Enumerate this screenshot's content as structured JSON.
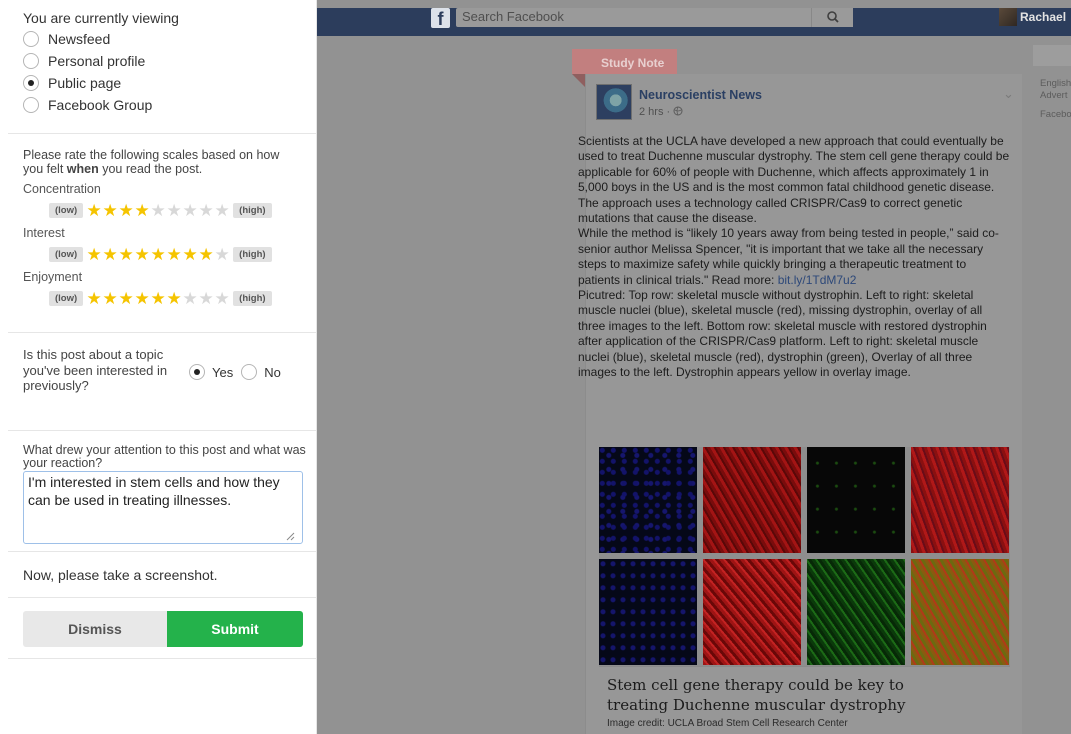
{
  "survey": {
    "viewing_title": "You are currently viewing",
    "viewing_options": [
      {
        "label": "Newsfeed",
        "selected": false
      },
      {
        "label": "Personal profile",
        "selected": false
      },
      {
        "label": "Public page",
        "selected": true
      },
      {
        "label": "Facebook Group",
        "selected": false
      }
    ],
    "rate_intro_before": "Please rate the following scales based on how you felt ",
    "rate_intro_bold": "when",
    "rate_intro_after": " you read the post.",
    "low_label": "(low)",
    "high_label": "(high)",
    "scales": [
      {
        "label": "Concentration",
        "rating": 4,
        "max": 9
      },
      {
        "label": "Interest",
        "rating": 8,
        "max": 9
      },
      {
        "label": "Enjoyment",
        "rating": 6,
        "max": 9
      }
    ],
    "topic_question": "Is this post about a topic you've been interested in previously?",
    "topic_yes": "Yes",
    "topic_no": "No",
    "topic_answer": "Yes",
    "reaction_question": "What drew your attention to this post and what was your reaction?",
    "reaction_value": "I'm interested in stem cells and how they can be used in treating illnesses. ",
    "screenshot_prompt": "Now, please take a screenshot.",
    "dismiss_label": "Dismiss",
    "submit_label": "Submit"
  },
  "facebook": {
    "search_placeholder": "Search Facebook",
    "user_name": "Rachael",
    "study_note_label": "Study Note",
    "side_lines": [
      "English",
      "Advert",
      "Facebo"
    ],
    "post": {
      "author": "Neuroscientist News",
      "meta": "2 hrs · ",
      "paragraphs": [
        "Scientists at the UCLA have developed a new approach that could eventually be used to treat Duchenne muscular dystrophy. The stem cell gene therapy could be applicable for 60% of people with Duchenne, which affects approximately 1 in 5,000 boys in the US and is the most common fatal childhood genetic disease.",
        "The approach uses a technology called CRISPR/Cas9 to correct genetic mutations that cause the disease."
      ],
      "quote_text": "While the method is “likely 10 years away from being tested in people,” said co-senior author Melissa Spencer, \"it is important that we take all the necessary steps to maximize safety while quickly bringing a therapeutic treatment to patients in clinical trials.\" Read more: ",
      "link_text": "bit.ly/1TdM7u2",
      "caption": "Picutred: Top row: skeletal muscle without dystrophin. Left to right: skeletal muscle nuclei (blue), skeletal muscle (red), missing dystrophin, overlay of all three images to the left. Bottom row: skeletal muscle with restored dystrophin after application of the CRISPR/Cas9 platform. Left to right: skeletal muscle nuclei (blue), skeletal muscle (red), dystrophin (green), Overlay of all three images to the left. Dystrophin appears yellow in overlay image.",
      "article_title": "Stem cell gene therapy could be key to treating Duchenne muscular dystrophy",
      "article_credit": "Image credit: UCLA Broad Stem Cell Research Center"
    }
  },
  "colors": {
    "accent_submit": "#24b24b",
    "star_on": "#f5c400",
    "fb_bar": "#2c3d5c"
  }
}
